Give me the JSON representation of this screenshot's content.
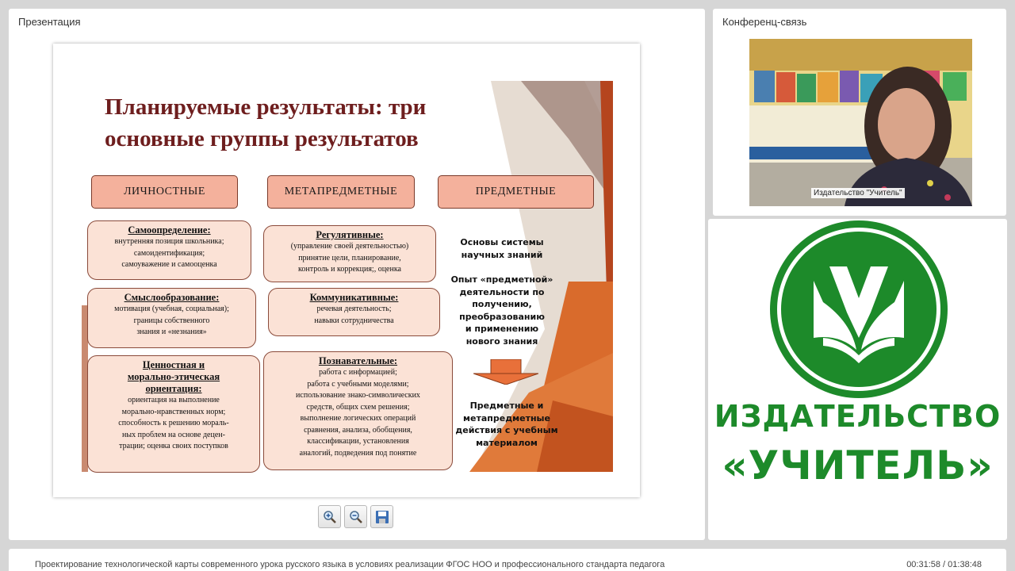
{
  "presentation": {
    "title": "Презентация",
    "slide": {
      "title_line1": "Планируемые результаты: три",
      "title_line2": "основные группы результатов",
      "columns": [
        {
          "header": "ЛИЧНОСТНЫЕ"
        },
        {
          "header": "МЕТАПРЕДМЕТНЫЕ"
        },
        {
          "header": "ПРЕДМЕТНЫЕ"
        }
      ],
      "personal_cards": [
        {
          "title": "Самоопределение:",
          "body": "внутренняя позиция школьника;\nсамоидентификация;\nсамоуважение и самооценка"
        },
        {
          "title": "Смыслообразование:",
          "body": "мотивация (учебная, социальная);\nграницы собственного\nзнания и «незнания»"
        },
        {
          "title": "Ценностная и\nморально-этическая\nориентация:",
          "body": "ориентация на выполнение\nморально-нравственных норм;\nспособность к решению мораль-\nных проблем на основе децен-\nтрации; оценка своих поступков"
        }
      ],
      "meta_cards": [
        {
          "title": "Регулятивные:",
          "body": "(управление своей деятельностью)\nпринятие цели, планирование,\nконтроль  и коррекция;,  оценка"
        },
        {
          "title": "Коммуникативные:",
          "body": "речевая деятельность;\nнавыки сотрудничества"
        },
        {
          "title": "Познавательные:",
          "body": "работа с информацией;\nработа с учебными моделями;\nиспользование знако-символических\nсредств, общих схем решения;\nвыполнение логических операций\nсравнения, анализа, обобщения,\nклассификации, установления\nаналогий, подведения под понятие"
        }
      ],
      "subject_texts": [
        "Основы системы\nнаучных знаний",
        "Опыт «предметной»\nдеятельности по\nполучению,\nпреобразованию\nи применению\nнового знания",
        "Предметные и\nметапредметные\nдействия с учебным\nматериалом"
      ]
    },
    "toolbar": [
      {
        "name": "zoom-in-icon"
      },
      {
        "name": "zoom-out-icon"
      },
      {
        "name": "save-icon"
      }
    ]
  },
  "conference": {
    "title": "Конференц-связь",
    "participant_name": "Издательство \"Учитель\""
  },
  "brand": {
    "line1": "ИЗДАТЕЛЬСТВО",
    "line2": "«УЧИТЕЛЬ»",
    "color": "#1d8a2a"
  },
  "footer": {
    "course_title": "Проектирование технологической карты современного урока русского языка в условиях реализации ФГОС НОО и профессионального стандарта педагога",
    "time": "00:31:58 / 01:38:48"
  }
}
